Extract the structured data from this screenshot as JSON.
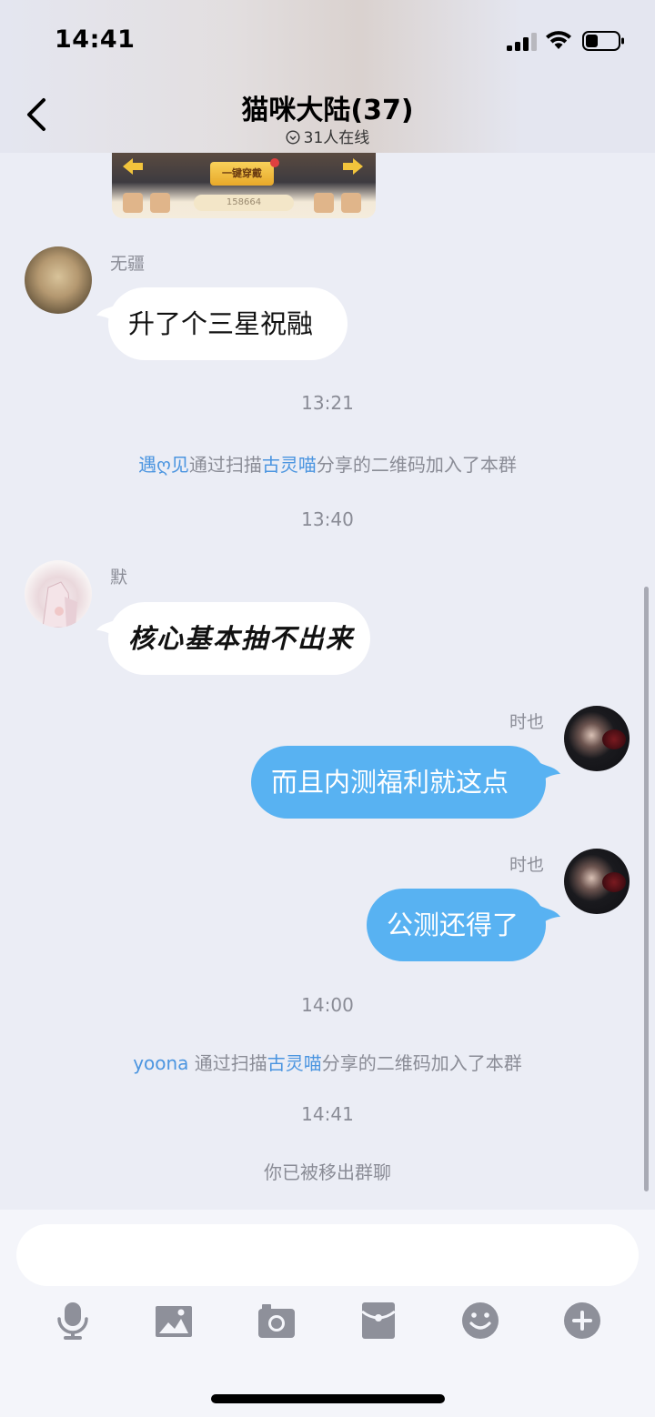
{
  "status_bar": {
    "time": "14:41"
  },
  "header": {
    "title": "猫咪大陆(37)",
    "online": "31人在线"
  },
  "game_image": {
    "equip_button": "一键穿戴",
    "score": "158664"
  },
  "messages": [
    {
      "sender": "无疆",
      "text": "升了个三星祝融",
      "direction": "incoming"
    },
    {
      "sender": "默",
      "text": "核心基本抽不出来",
      "direction": "incoming"
    },
    {
      "sender": "时也",
      "text": "而且内测福利就这点",
      "direction": "outgoing"
    },
    {
      "sender": "时也",
      "text": "公测还得了",
      "direction": "outgoing"
    }
  ],
  "timestamps": [
    "13:21",
    "13:40",
    "14:00",
    "14:41"
  ],
  "system": {
    "join1": {
      "user": "遇ღ见",
      "mid": "通过扫描",
      "sharer": "古灵喵",
      "tail": "分享的二维码加入了本群"
    },
    "join2": {
      "user": "yoona",
      "mid": " 通过扫描",
      "sharer": "古灵喵",
      "tail": "分享的二维码加入了本群"
    },
    "removed": "你已被移出群聊"
  },
  "toolbar": {
    "icons": [
      "microphone-icon",
      "image-icon",
      "camera-icon",
      "red-packet-icon",
      "emoji-icon",
      "plus-icon"
    ]
  },
  "colors": {
    "background": "#ebedf5",
    "outgoing_bubble": "#58b2f2",
    "incoming_bubble": "#ffffff",
    "link": "#4b95e0",
    "icon_gray": "#8e909a"
  }
}
